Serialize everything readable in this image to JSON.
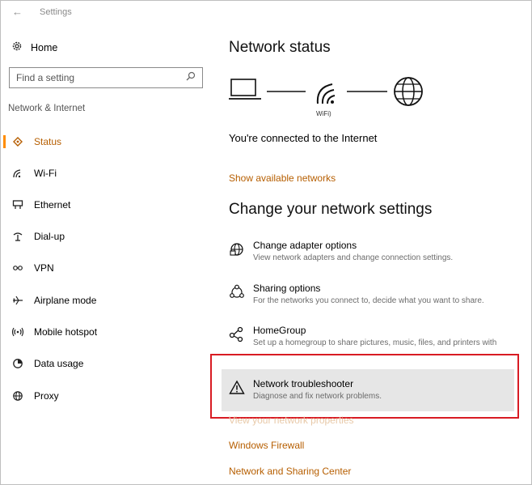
{
  "window": {
    "back_glyph": "←",
    "title": "Settings"
  },
  "sidebar": {
    "home_label": "Home",
    "search_placeholder": "Find a setting",
    "section_title": "Network & Internet",
    "items": [
      {
        "label": "Status",
        "icon": "status-icon",
        "active": true
      },
      {
        "label": "Wi-Fi",
        "icon": "wifi-icon",
        "active": false
      },
      {
        "label": "Ethernet",
        "icon": "ethernet-icon",
        "active": false
      },
      {
        "label": "Dial-up",
        "icon": "dialup-icon",
        "active": false
      },
      {
        "label": "VPN",
        "icon": "vpn-icon",
        "active": false
      },
      {
        "label": "Airplane mode",
        "icon": "airplane-icon",
        "active": false
      },
      {
        "label": "Mobile hotspot",
        "icon": "hotspot-icon",
        "active": false
      },
      {
        "label": "Data usage",
        "icon": "data-usage-icon",
        "active": false
      },
      {
        "label": "Proxy",
        "icon": "proxy-icon",
        "active": false
      }
    ]
  },
  "main": {
    "network_status_title": "Network status",
    "wifi_caption": "WiFi)",
    "connected_text": "You're connected to the Internet",
    "show_networks_link": "Show available networks",
    "change_settings_title": "Change your network settings",
    "options": [
      {
        "title": "Change adapter options",
        "desc": "View network adapters and change connection settings.",
        "icon": "adapter-icon"
      },
      {
        "title": "Sharing options",
        "desc": "For the networks you connect to, decide what you want to share.",
        "icon": "sharing-icon"
      },
      {
        "title": "HomeGroup",
        "desc": "Set up a homegroup to share pictures, music, files, and printers with",
        "icon": "homegroup-icon"
      },
      {
        "title": "Network troubleshooter",
        "desc": "Diagnose and fix network problems.",
        "icon": "warning-icon"
      }
    ],
    "links": [
      {
        "label": "View your network properties"
      },
      {
        "label": "Windows Firewall"
      },
      {
        "label": "Network and Sharing Center"
      }
    ]
  },
  "colors": {
    "accent": "#b65e00",
    "active_bar": "#ff8c00",
    "highlight_border": "#d81b23",
    "hover_bg": "#e6e6e6"
  }
}
